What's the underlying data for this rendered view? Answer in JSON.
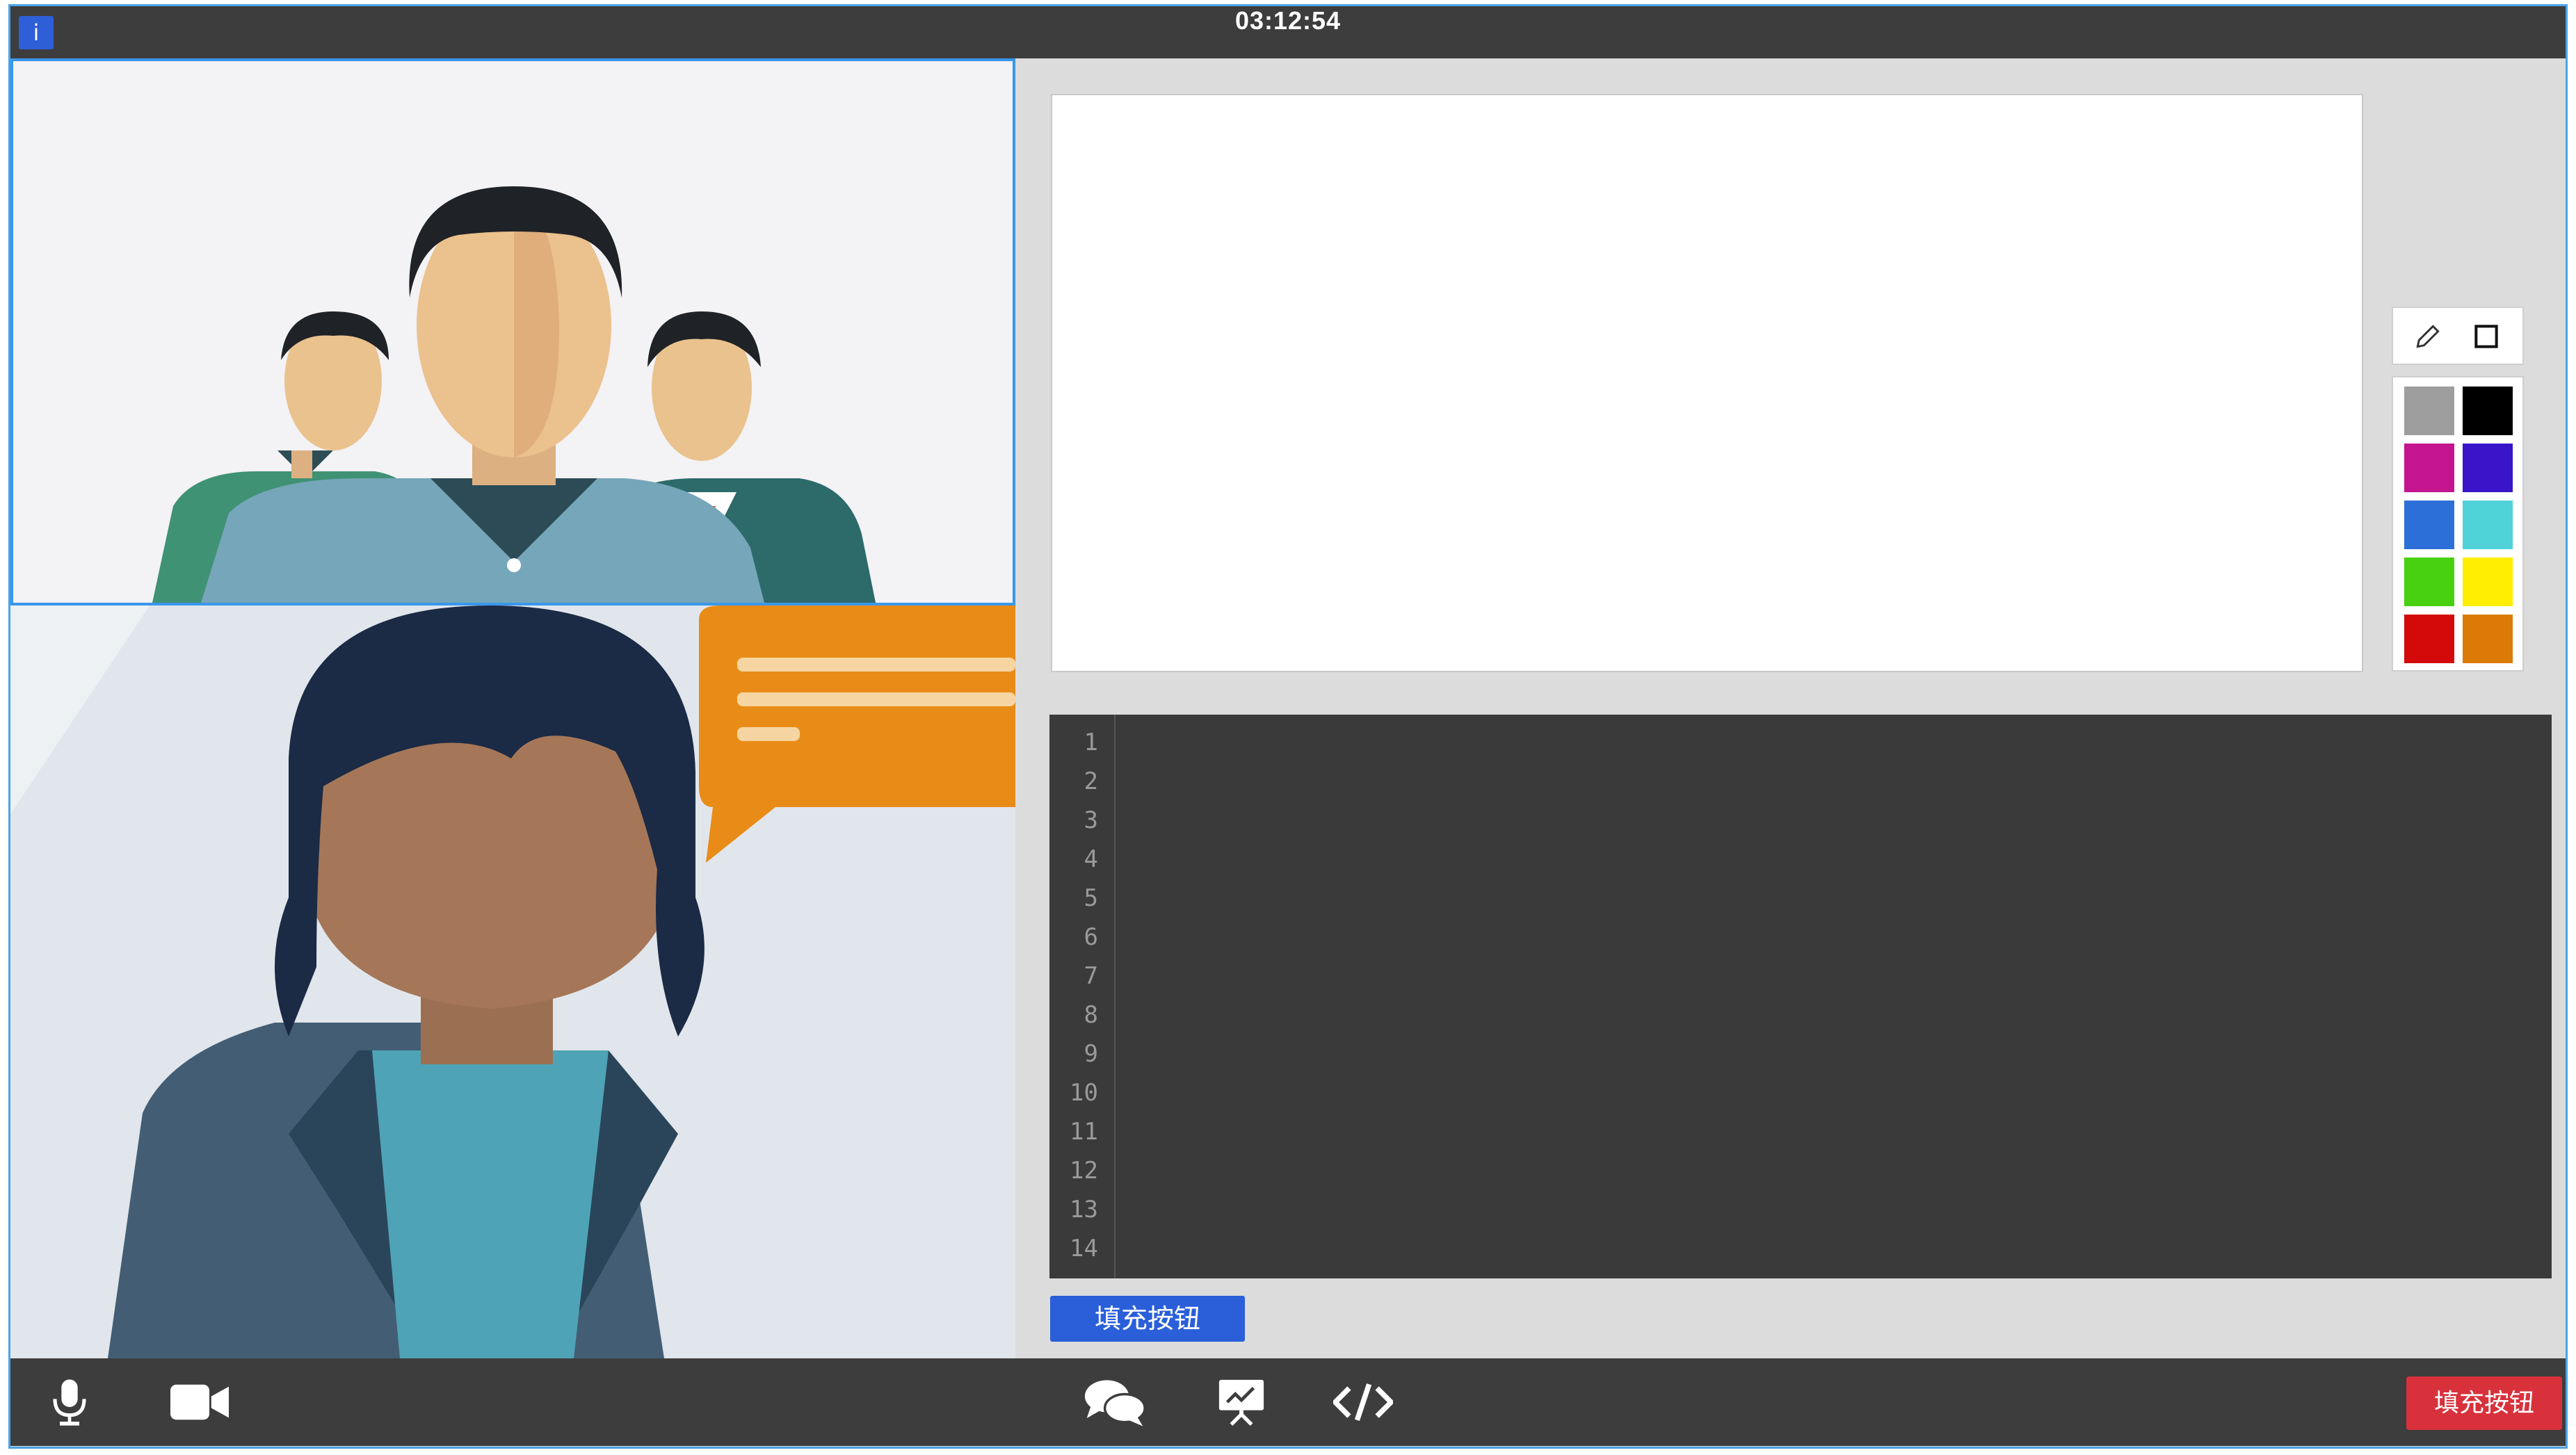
{
  "header": {
    "info_label": "i",
    "timer": "03:12:54"
  },
  "participants": [
    {
      "name": "group-participants"
    },
    {
      "name": "female-participant"
    }
  ],
  "whiteboard": {
    "tools": [
      "pencil-icon",
      "rectangle-icon"
    ],
    "colors": [
      "#9e9e9e",
      "#000000",
      "#c4158f",
      "#3a14c9",
      "#2d6fd8",
      "#4fd3d9",
      "#48d111",
      "#ffee00",
      "#d40a0a",
      "#db7a07"
    ]
  },
  "editor": {
    "line_numbers": [
      "1",
      "2",
      "3",
      "4",
      "5",
      "6",
      "7",
      "8",
      "9",
      "10",
      "11",
      "12",
      "13",
      "14"
    ]
  },
  "fill_button_label": "填充按钮",
  "toolbar": {
    "icons": [
      "microphone-icon",
      "camera-icon",
      "chat-icon",
      "presentation-icon",
      "code-icon"
    ],
    "end_button_label": "填充按钮"
  }
}
